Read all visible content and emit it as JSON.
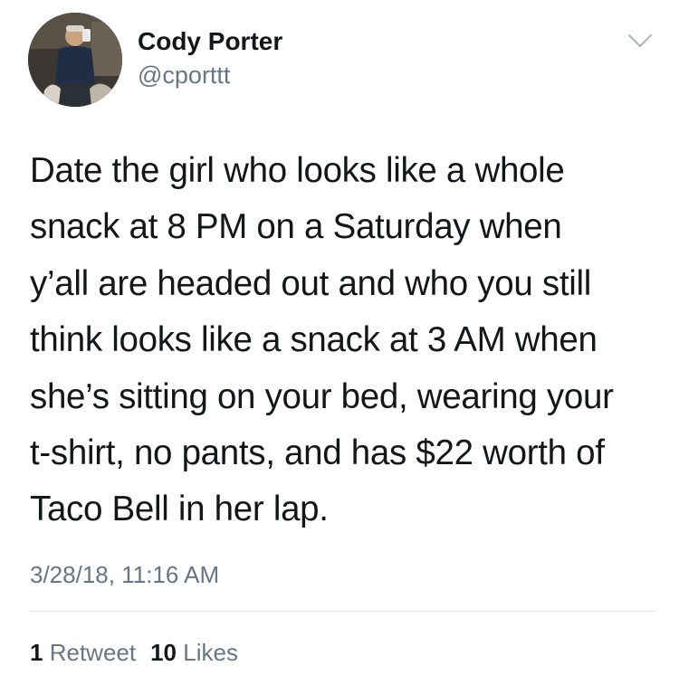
{
  "tweet": {
    "author": {
      "name": "Cody Porter",
      "handle": "@cporttt"
    },
    "icons": {
      "menu": "chevron-down-icon",
      "avatar": "profile-photo"
    },
    "text_lines": [
      "Date the girl who looks like a whole",
      "snack at 8 PM on a Saturday when",
      "y’all are headed out and who you still",
      "think looks like a snack at 3 AM when",
      "she’s sitting on your bed, wearing your",
      "t-shirt, no pants, and has $22 worth of",
      "Taco Bell in her lap."
    ],
    "timestamp": "3/28/18, 11:16 AM",
    "stats": {
      "retweets_count": "1",
      "retweets_label": "Retweet",
      "likes_count": "10",
      "likes_label": "Likes"
    }
  },
  "colors": {
    "text_primary": "#14171a",
    "text_secondary": "#657786",
    "divider": "#e1e8ed"
  }
}
